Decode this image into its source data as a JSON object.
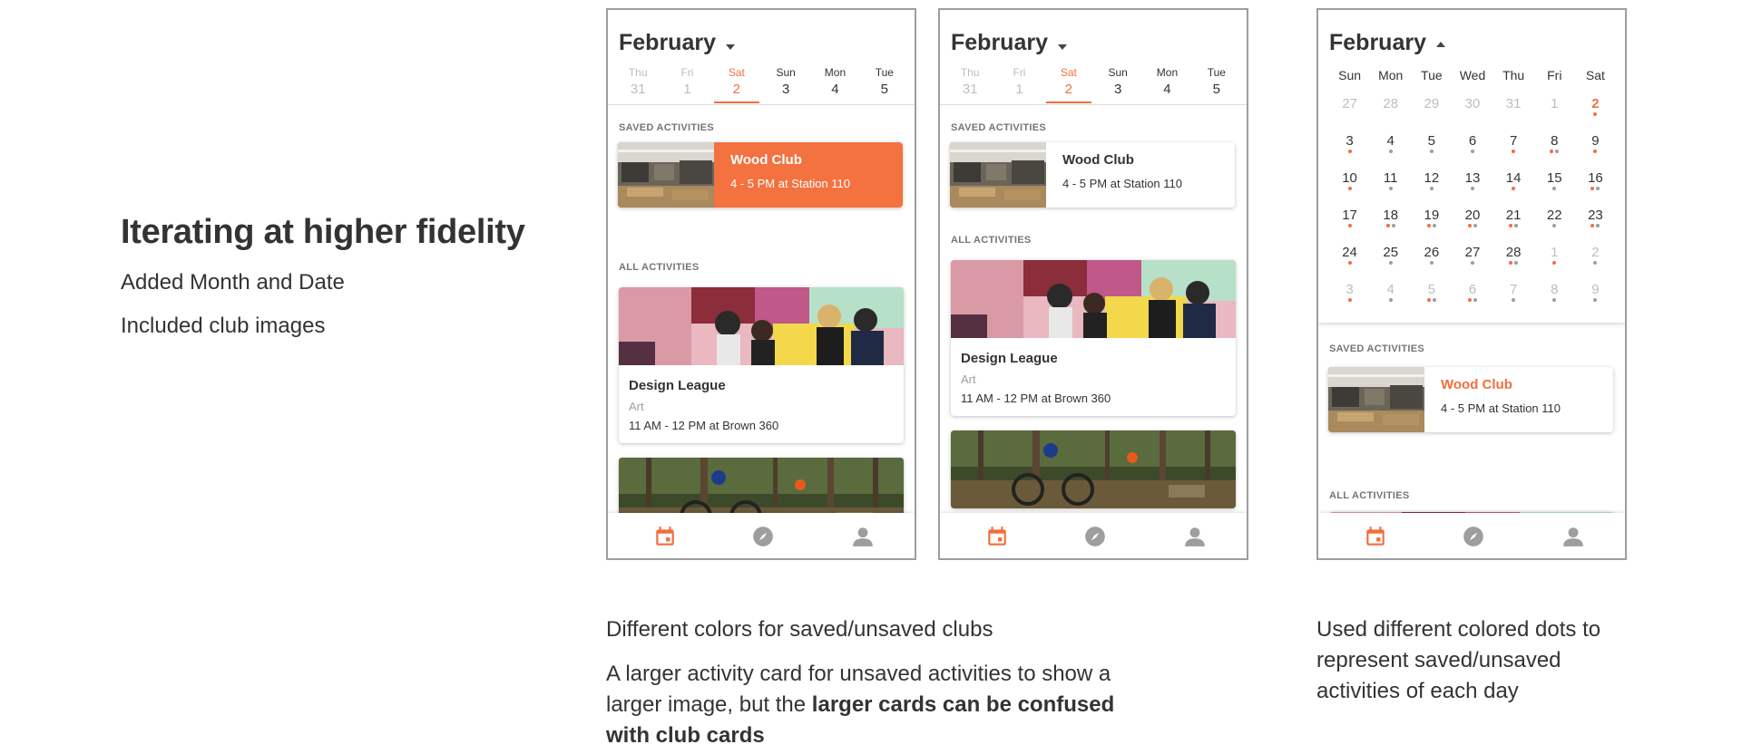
{
  "intro": {
    "title": "Iterating at higher fidelity",
    "line1": "Added Month and Date",
    "line2": "Included club images"
  },
  "colors": {
    "accent": "#f36e3d",
    "saved_card": "#f47240",
    "muted": "#9e9e9e"
  },
  "icons": {
    "tab1": "calendar-icon",
    "tab2": "compass-icon",
    "tab3": "person-icon"
  },
  "week_strip": [
    {
      "dow": "Thu",
      "num": "31",
      "state": "past"
    },
    {
      "dow": "Fri",
      "num": "1",
      "state": "past"
    },
    {
      "dow": "Sat",
      "num": "2",
      "state": "selected"
    },
    {
      "dow": "Sun",
      "num": "3",
      "state": "normal"
    },
    {
      "dow": "Mon",
      "num": "4",
      "state": "normal"
    },
    {
      "dow": "Tue",
      "num": "5",
      "state": "normal"
    }
  ],
  "phone1": {
    "month": "February",
    "saved_heading": "SAVED ACTIVITIES",
    "all_heading": "ALL ACTIVITIES",
    "saved_card": {
      "title": "Wood Club",
      "detail": "4 - 5 PM at  Station 110"
    },
    "big_card": {
      "title": "Design League",
      "category": "Art",
      "detail": "11 AM - 12 PM at Brown 360"
    }
  },
  "phone2": {
    "month": "February",
    "saved_heading": "SAVED ACTIVITIES",
    "all_heading": "ALL ACTIVITIES",
    "saved_card": {
      "title": "Wood Club",
      "detail": "4 - 5 PM at  Station 110"
    },
    "big_card": {
      "title": "Design League",
      "category": "Art",
      "detail": "11 AM - 12 PM at Brown 360"
    }
  },
  "phone3": {
    "month": "February",
    "weekdays": [
      "Sun",
      "Mon",
      "Tue",
      "Wed",
      "Thu",
      "Fri",
      "Sat"
    ],
    "weeks": [
      [
        {
          "n": "27",
          "dim": true
        },
        {
          "n": "28",
          "dim": true
        },
        {
          "n": "29",
          "dim": true
        },
        {
          "n": "30",
          "dim": true
        },
        {
          "n": "31",
          "dim": true
        },
        {
          "n": "1",
          "dim": true
        },
        {
          "n": "2",
          "today": true,
          "d": "s"
        }
      ],
      [
        {
          "n": "3",
          "d": "s"
        },
        {
          "n": "4",
          "d": "u"
        },
        {
          "n": "5",
          "d": "u"
        },
        {
          "n": "6",
          "d": "u"
        },
        {
          "n": "7",
          "d": "s"
        },
        {
          "n": "8",
          "d": "su"
        },
        {
          "n": "9",
          "d": "s"
        }
      ],
      [
        {
          "n": "10",
          "d": "s"
        },
        {
          "n": "11",
          "d": "u"
        },
        {
          "n": "12",
          "d": "u"
        },
        {
          "n": "13",
          "d": "u"
        },
        {
          "n": "14",
          "d": "s"
        },
        {
          "n": "15",
          "d": "u"
        },
        {
          "n": "16",
          "d": "su"
        }
      ],
      [
        {
          "n": "17",
          "d": "s"
        },
        {
          "n": "18",
          "d": "su"
        },
        {
          "n": "19",
          "d": "su"
        },
        {
          "n": "20",
          "d": "su"
        },
        {
          "n": "21",
          "d": "su"
        },
        {
          "n": "22",
          "d": "u"
        },
        {
          "n": "23",
          "d": "su"
        }
      ],
      [
        {
          "n": "24",
          "d": "s"
        },
        {
          "n": "25",
          "d": "u"
        },
        {
          "n": "26",
          "d": "u"
        },
        {
          "n": "27",
          "d": "u"
        },
        {
          "n": "28",
          "d": "su"
        },
        {
          "n": "1",
          "dim": true,
          "d": "s"
        },
        {
          "n": "2",
          "dim": true,
          "d": "u"
        }
      ],
      [
        {
          "n": "3",
          "dim": true,
          "d": "s"
        },
        {
          "n": "4",
          "dim": true,
          "d": "u"
        },
        {
          "n": "5",
          "dim": true,
          "d": "su"
        },
        {
          "n": "6",
          "dim": true,
          "d": "su"
        },
        {
          "n": "7",
          "dim": true,
          "d": "u"
        },
        {
          "n": "8",
          "dim": true,
          "d": "u"
        },
        {
          "n": "9",
          "dim": true,
          "d": "u"
        }
      ]
    ],
    "saved_heading": "SAVED ACTIVITIES",
    "all_heading": "ALL ACTIVITIES",
    "saved_card": {
      "title": "Wood Club",
      "detail": "4 - 5 PM at  Station 110"
    }
  },
  "captions": {
    "c1": "Different colors for saved/unsaved clubs",
    "c2_plain": "A larger activity card for unsaved activities to show a larger image, but the ",
    "c2_bold": "larger cards can be confused with club cards",
    "c3": "Used different colored dots to represent saved/unsaved activities of each day"
  }
}
